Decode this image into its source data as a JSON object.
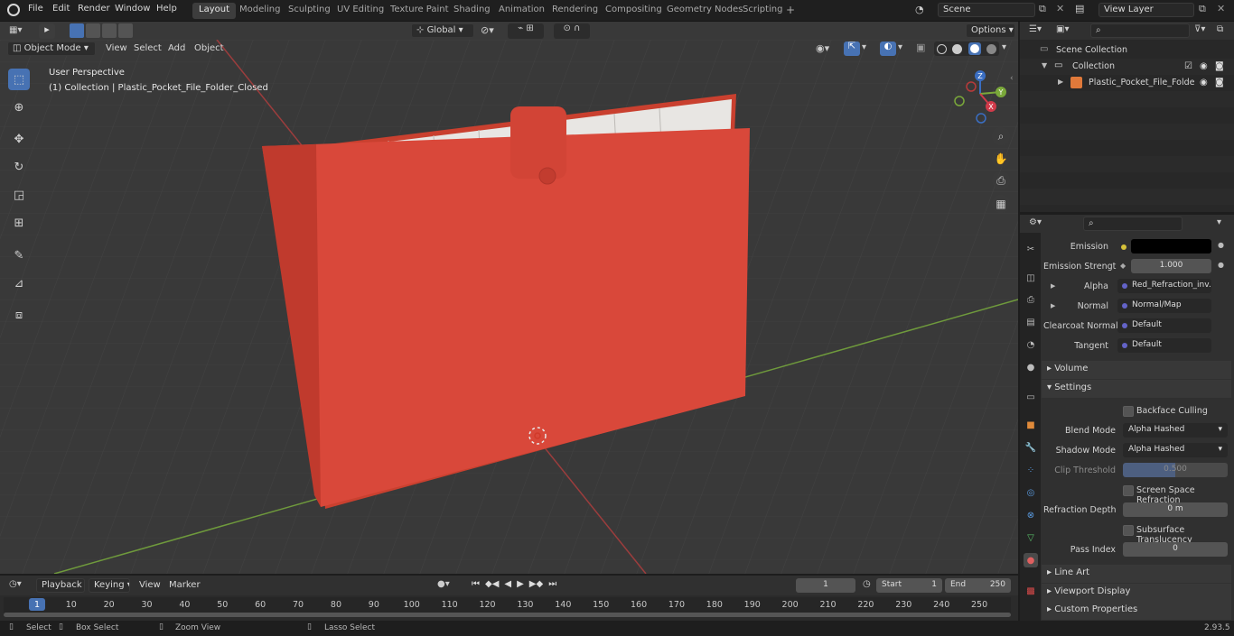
{
  "menu": {
    "file": "File",
    "edit": "Edit",
    "render": "Render",
    "window": "Window",
    "help": "Help"
  },
  "workspaces": [
    "Layout",
    "Modeling",
    "Sculpting",
    "UV Editing",
    "Texture Paint",
    "Shading",
    "Animation",
    "Rendering",
    "Compositing",
    "Geometry Nodes",
    "Scripting"
  ],
  "scene": {
    "name": "Scene",
    "view_layer": "View Layer"
  },
  "viewport_header": {
    "mode": "Object Mode",
    "view": "View",
    "select": "Select",
    "add": "Add",
    "object": "Object",
    "orientation": "Global",
    "options": "Options"
  },
  "viewport": {
    "perspective": "User Perspective",
    "collection_info": "(1) Collection | Plastic_Pocket_File_Folder_Closed"
  },
  "gizmo": {
    "x": "X",
    "y": "Y",
    "z": "Z"
  },
  "outliner": {
    "scene_collection": "Scene Collection",
    "collection": "Collection",
    "object": "Plastic_Pocket_File_Folde"
  },
  "properties": {
    "emission_label": "Emission",
    "emission_color": "#000000",
    "emission_strength_label": "Emission Strengt",
    "emission_strength": "1.000",
    "alpha_label": "Alpha",
    "alpha_value": "Red_Refraction_inv...",
    "normal_label": "Normal",
    "normal_value": "Normal/Map",
    "clearcoat_label": "Clearcoat Normal",
    "clearcoat_value": "Default",
    "tangent_label": "Tangent",
    "tangent_value": "Default",
    "volume": "Volume",
    "settings": "Settings",
    "backface": "Backface Culling",
    "blend_label": "Blend Mode",
    "blend_value": "Alpha Hashed",
    "shadow_label": "Shadow Mode",
    "shadow_value": "Alpha Hashed",
    "clip_label": "Clip Threshold",
    "clip_value": "0.500",
    "clip_fraction": 0.5,
    "ssr": "Screen Space Refraction",
    "refraction_label": "Refraction Depth",
    "refraction_value": "0 m",
    "sss": "Subsurface Translucency",
    "pass_label": "Pass Index",
    "pass_value": "0",
    "line_art": "Line Art",
    "viewport_display": "Viewport Display",
    "custom_props": "Custom Properties"
  },
  "timeline": {
    "playback": "Playback",
    "keying": "Keying",
    "view": "View",
    "marker": "Marker",
    "current_frame": "1",
    "start_label": "Start",
    "start": "1",
    "end_label": "End",
    "end": "250",
    "ticks": [
      "1",
      "10",
      "20",
      "30",
      "40",
      "50",
      "60",
      "70",
      "80",
      "90",
      "100",
      "110",
      "120",
      "130",
      "140",
      "150",
      "160",
      "170",
      "180",
      "190",
      "200",
      "210",
      "220",
      "230",
      "240",
      "250"
    ]
  },
  "status": {
    "select": "Select",
    "box_select": "Box Select",
    "zoom_view": "Zoom View",
    "lasso_select": "Lasso Select",
    "version": "2.93.5"
  },
  "colors": {
    "folder": "#d9483a",
    "accent": "#4772b3",
    "x_axis": "#b83a3a",
    "y_axis": "#7aa83a"
  }
}
